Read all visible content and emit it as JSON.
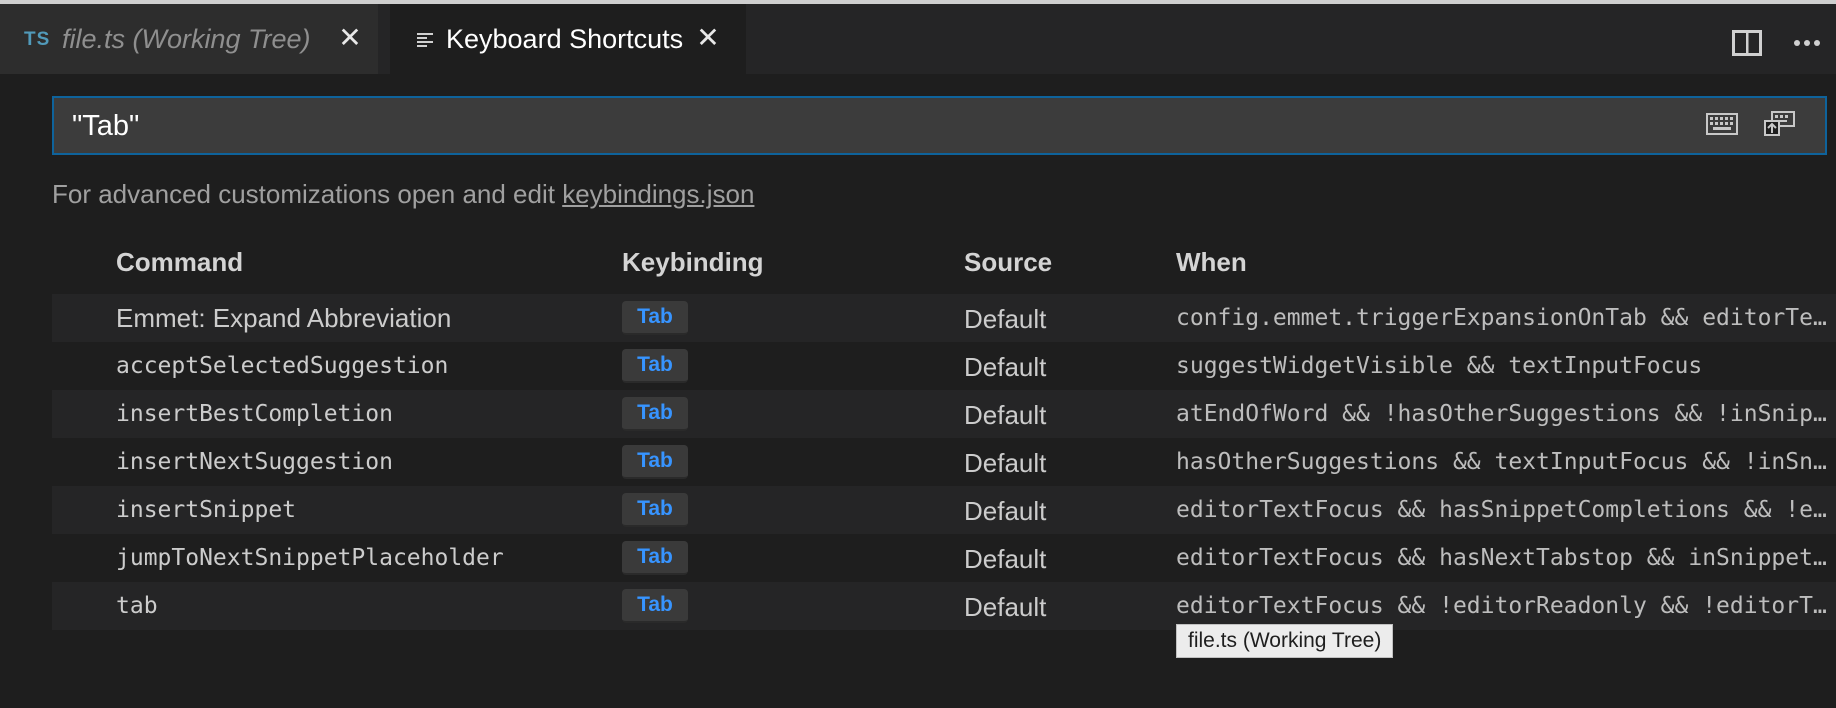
{
  "tabs": [
    {
      "badge": "TS",
      "label": "file.ts (Working Tree)",
      "close": "✕"
    },
    {
      "label": "Keyboard Shortcuts",
      "close": "✕"
    }
  ],
  "search": {
    "value": "\"Tab\""
  },
  "hint": {
    "text": "For advanced customizations open and edit ",
    "link": "keybindings.json"
  },
  "table": {
    "headers": {
      "command": "Command",
      "keybinding": "Keybinding",
      "source": "Source",
      "when": "When"
    },
    "rows": [
      {
        "command": "Emmet: Expand Abbreviation",
        "keybinding": "Tab",
        "source": "Default",
        "when": "config.emmet.triggerExpansionOnTab && editorTextFocus"
      },
      {
        "command": "acceptSelectedSuggestion",
        "keybinding": "Tab",
        "source": "Default",
        "when": "suggestWidgetVisible && textInputFocus"
      },
      {
        "command": "insertBestCompletion",
        "keybinding": "Tab",
        "source": "Default",
        "when": "atEndOfWord && !hasOtherSuggestions && !inSnippetMode"
      },
      {
        "command": "insertNextSuggestion",
        "keybinding": "Tab",
        "source": "Default",
        "when": "hasOtherSuggestions && textInputFocus && !inSnippetMode"
      },
      {
        "command": "insertSnippet",
        "keybinding": "Tab",
        "source": "Default",
        "when": "editorTextFocus && hasSnippetCompletions && !editorTabMovesFocus"
      },
      {
        "command": "jumpToNextSnippetPlaceholder",
        "keybinding": "Tab",
        "source": "Default",
        "when": "editorTextFocus && hasNextTabstop && inSnippetMode"
      },
      {
        "command": "tab",
        "keybinding": "Tab",
        "source": "Default",
        "when": "editorTextFocus && !editorReadonly && !editorTabMovesFocus"
      }
    ]
  },
  "tooltip": {
    "text": "file.ts (Working Tree)"
  },
  "icons": {
    "tab_2": "keyboard-shortcuts-icon",
    "split": "split-editor-icon",
    "more": "more-actions-icon",
    "record_keys": "keyboard-icon",
    "sort": "sort-by-precedence-icon"
  },
  "colors": {
    "accent": "#0e639c",
    "key": "#3794ff",
    "ts": "#519aba"
  }
}
